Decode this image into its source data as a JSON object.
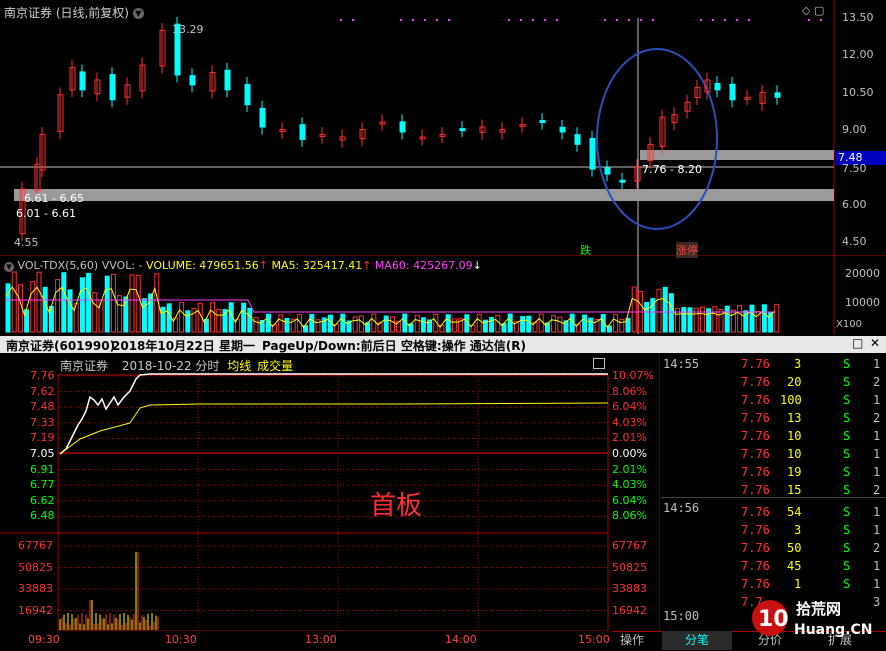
{
  "kline": {
    "title": "南京证券 (日线,前复权)",
    "price_axis": [
      "13.50",
      "12.00",
      "10.50",
      "9.00",
      "7.50",
      "6.00",
      "4.50"
    ],
    "current_price_tag": "7.48",
    "high_label": "13.29",
    "low_label": "4.55",
    "gap_labels": [
      "6.61 - 6.65",
      "6.01 - 6.61",
      "7.76 - 8.20"
    ],
    "markers": [
      "跌",
      "涨停"
    ],
    "marker_colors": [
      "#00ff00",
      "#ff4040"
    ]
  },
  "volume": {
    "indicator_name": "VOL-TDX(5,60)",
    "vvol": "VVOL: -",
    "volume_label": "VOLUME: 479651.56",
    "ma5_label": "MA5: 325417.41",
    "ma60_label": "MA60: 425267.09",
    "axis": [
      "20000",
      "10000"
    ],
    "unit": "X100",
    "ma5_color": "#ffff00",
    "ma60_color": "#ff40ff"
  },
  "header": {
    "stock": "南京证券(601990)",
    "date": "2018年10月22日 星期一",
    "hint": "PageUp/Down:前后日 空格键:操作 通达信(R)"
  },
  "intraday": {
    "title": "南京证券",
    "date": "2018-10-22 分时",
    "avg_label": "均线",
    "vol_label": "成交量",
    "left_prices": [
      "7.76",
      "7.62",
      "7.48",
      "7.33",
      "7.19",
      "7.05",
      "6.91",
      "6.77",
      "6.62",
      "6.48"
    ],
    "right_pcts": [
      "10.07%",
      "8.06%",
      "6.04%",
      "4.03%",
      "2.01%",
      "0.00%",
      "2.01%",
      "4.03%",
      "6.04%",
      "8.06%"
    ],
    "vol_left": [
      "67767",
      "50825",
      "33883",
      "16942"
    ],
    "vol_right": [
      "67767",
      "50825",
      "33883",
      "16942"
    ],
    "time_axis": [
      "09:30",
      "10:30",
      "13:00",
      "14:00",
      "15:00"
    ],
    "annotation": "首板",
    "up_color": "#ff3030",
    "down_color": "#00ff00"
  },
  "trades": {
    "time_groups": [
      "14:55",
      "14:56",
      "15:00"
    ],
    "rows": [
      {
        "price": "7.76",
        "vol": "3",
        "bs": "S",
        "n": "1"
      },
      {
        "price": "7.76",
        "vol": "20",
        "bs": "S",
        "n": "2"
      },
      {
        "price": "7.76",
        "vol": "100",
        "bs": "S",
        "n": "1"
      },
      {
        "price": "7.76",
        "vol": "13",
        "bs": "S",
        "n": "2"
      },
      {
        "price": "7.76",
        "vol": "10",
        "bs": "S",
        "n": "1"
      },
      {
        "price": "7.76",
        "vol": "10",
        "bs": "S",
        "n": "1"
      },
      {
        "price": "7.76",
        "vol": "19",
        "bs": "S",
        "n": "1"
      },
      {
        "price": "7.76",
        "vol": "15",
        "bs": "S",
        "n": "2"
      },
      {
        "price": "7.76",
        "vol": "54",
        "bs": "S",
        "n": "1"
      },
      {
        "price": "7.76",
        "vol": "3",
        "bs": "S",
        "n": "1"
      },
      {
        "price": "7.76",
        "vol": "50",
        "bs": "S",
        "n": "2"
      },
      {
        "price": "7.76",
        "vol": "45",
        "bs": "S",
        "n": "1"
      },
      {
        "price": "7.76",
        "vol": "1",
        "bs": "S",
        "n": "1"
      },
      {
        "price": "7.7",
        "vol": "",
        "bs": "",
        "n": "3"
      }
    ]
  },
  "tabs": [
    "操作",
    "分笔",
    "分价",
    "扩展"
  ],
  "watermark": "拾荒网 10Huang.CN"
}
